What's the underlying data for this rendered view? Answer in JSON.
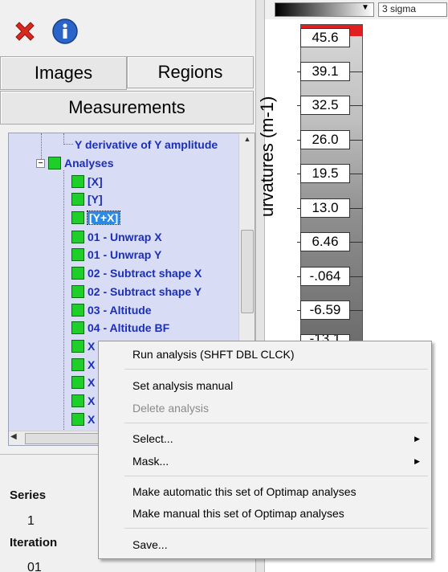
{
  "toolbar": {
    "close_icon": "red-x-icon",
    "info_icon": "blue-info-icon"
  },
  "tabs": {
    "images": "Images",
    "regions": "Regions",
    "measurements": "Measurements"
  },
  "tree": {
    "items": [
      {
        "label": "Y derivative of Y amplitude"
      },
      {
        "label": "Analyses"
      },
      {
        "label": "[X]"
      },
      {
        "label": "[Y]"
      },
      {
        "label": "[Y+X]"
      },
      {
        "label": "01 - Unwrap X"
      },
      {
        "label": "01 - Unwrap Y"
      },
      {
        "label": "02 - Subtract shape X"
      },
      {
        "label": "02 - Subtract shape Y"
      },
      {
        "label": "03 - Altitude"
      },
      {
        "label": "04 - Altitude BF"
      },
      {
        "label": "X"
      },
      {
        "label": "X"
      },
      {
        "label": "X"
      },
      {
        "label": "X"
      },
      {
        "label": "X"
      }
    ]
  },
  "lower": {
    "series_label": "Series",
    "series_value": "1",
    "iteration_label": "Iteration",
    "iteration_value": "01"
  },
  "right": {
    "sigma_value": "3 sigma",
    "ylabel": "urvatures (m-1)",
    "ticks": [
      "45.6",
      "39.1",
      "32.5",
      "26.0",
      "19.5",
      "13.0",
      "6.46",
      "-.064",
      "-6.59"
    ],
    "partial_tick": "-13.1"
  },
  "context_menu": {
    "run_analysis": "Run analysis (SHFT DBL CLCK)",
    "set_manual": "Set analysis manual",
    "delete_analysis": "Delete analysis",
    "select": "Select...",
    "mask": "Mask...",
    "make_automatic": "Make automatic this set of Optimap analyses",
    "make_manual": "Make manual this set of Optimap analyses",
    "save": "Save..."
  },
  "colors": {
    "green_node": "#1ecf2a",
    "tree_text": "#1c2fb8",
    "selection": "#2c8ae6",
    "colorbar_top": "#e02020"
  }
}
